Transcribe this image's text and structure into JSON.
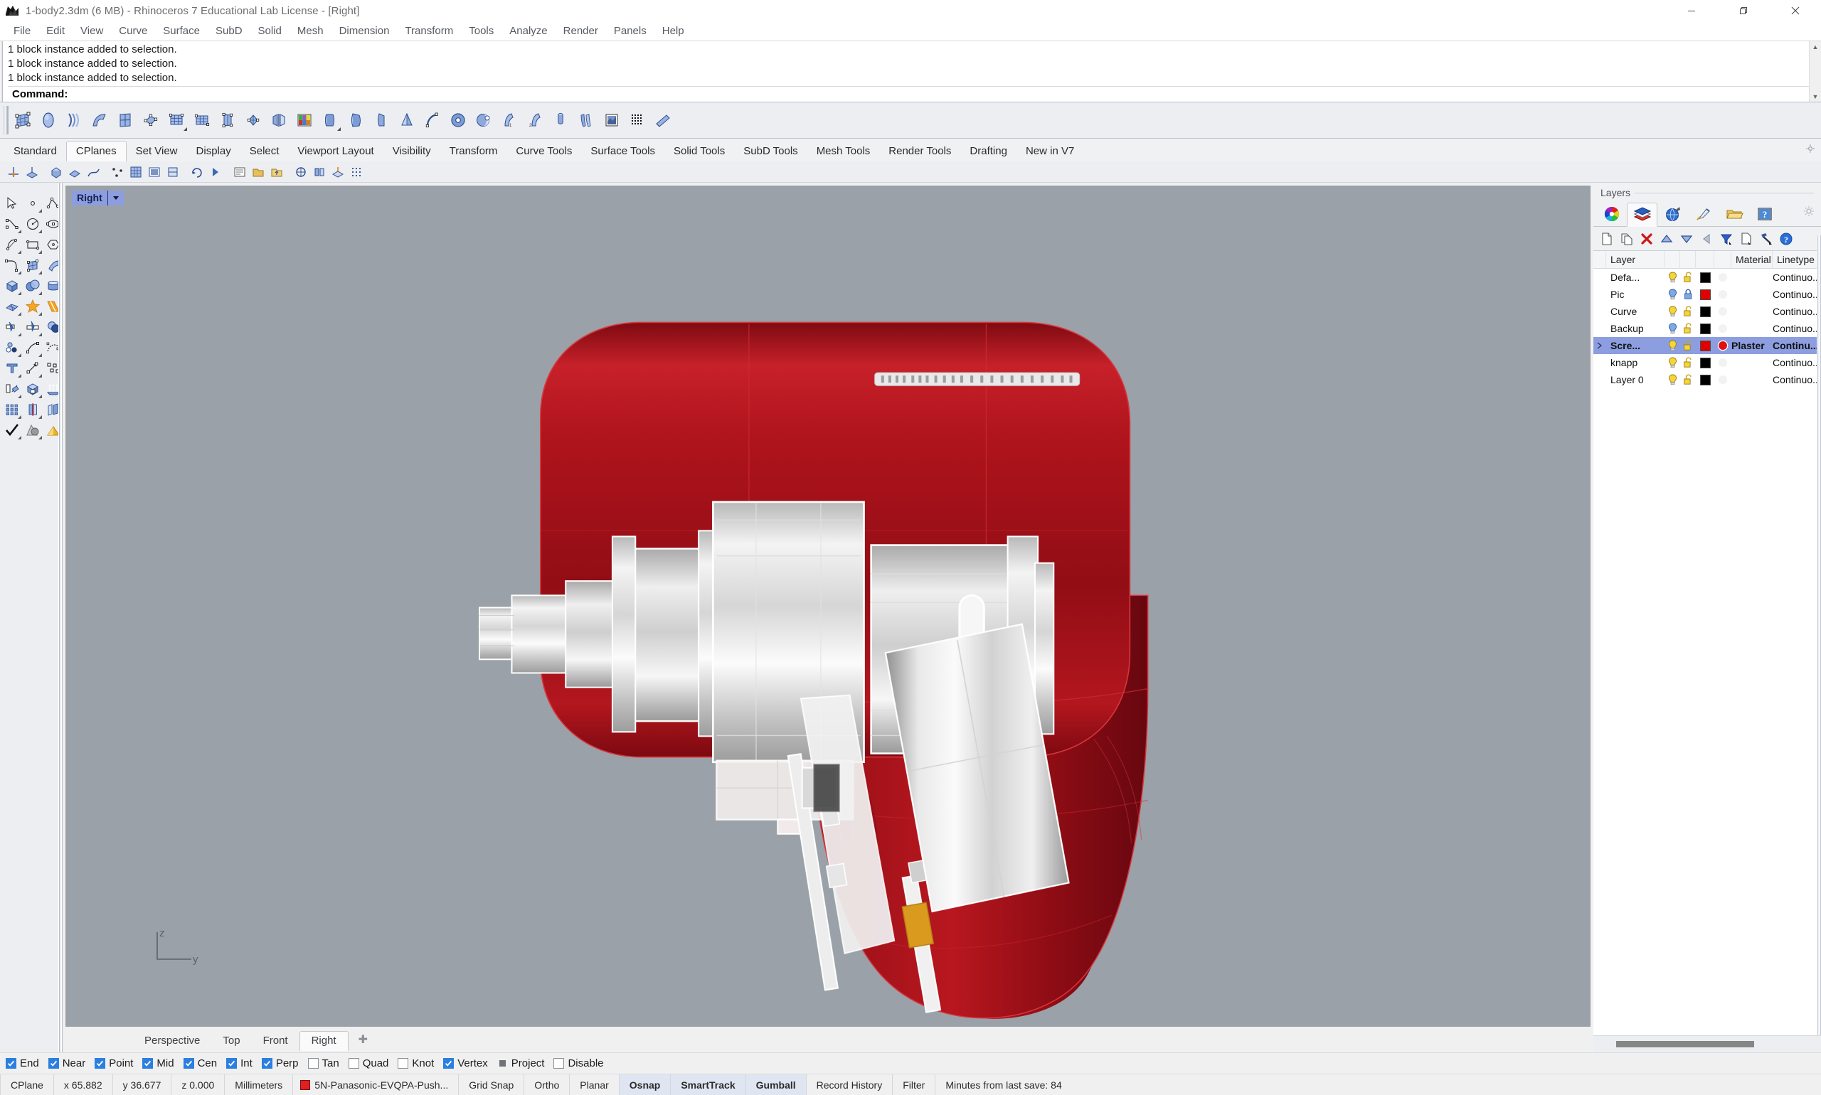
{
  "window": {
    "title": "1-body2.3dm (6 MB) - Rhinoceros 7 Educational Lab License - [Right]",
    "app_icon": "rhino-icon",
    "minimize_label": "Minimize",
    "restore_label": "Restore",
    "close_label": "Close"
  },
  "menu": {
    "items": [
      "File",
      "Edit",
      "View",
      "Curve",
      "Surface",
      "SubD",
      "Solid",
      "Mesh",
      "Dimension",
      "Transform",
      "Tools",
      "Analyze",
      "Render",
      "Panels",
      "Help"
    ]
  },
  "command_pane": {
    "history": [
      "1 block instance added to selection.",
      "1 block instance added to selection.",
      "1 block instance added to selection."
    ],
    "prompt_label": "Command:",
    "prompt_value": "",
    "scroll_up": "▲",
    "scroll_down": "▼"
  },
  "main_toolbar": {
    "buttons": [
      {
        "name": "surface-from-network-of-curves",
        "icon": "surface-network-icon"
      },
      {
        "name": "surface-from-planar-curves",
        "icon": "surface-planar-icon"
      },
      {
        "name": "loft",
        "icon": "loft-icon"
      },
      {
        "name": "sweep-1-rail",
        "icon": "sweep1-icon"
      },
      {
        "name": "sweep-2-rails",
        "icon": "sweep2-icon"
      },
      {
        "name": "surface-from-3-4-points",
        "icon": "surface-corner-points-icon"
      },
      {
        "name": "rebuild-surface",
        "icon": "rebuild-surface-icon"
      },
      {
        "name": "change-degree",
        "icon": "change-degree-icon"
      },
      {
        "name": "surface-edit-points",
        "icon": "surface-points-on-icon"
      },
      {
        "name": "match-surface",
        "icon": "match-surface-icon"
      },
      {
        "name": "symmetry",
        "icon": "symmetry-icon"
      },
      {
        "name": "render-color-swatch",
        "icon": "color-palette-icon"
      },
      {
        "name": "extrude-straight",
        "icon": "extrude-icon"
      },
      {
        "name": "extrude-tapered",
        "icon": "extrude-taper-icon"
      },
      {
        "name": "extrude-along-curve",
        "icon": "extrude-curve-icon"
      },
      {
        "name": "cone",
        "icon": "cone-icon"
      },
      {
        "name": "revolve",
        "icon": "revolve-icon"
      },
      {
        "name": "torus",
        "icon": "torus-icon"
      },
      {
        "name": "sphere",
        "icon": "sphere-icon"
      },
      {
        "name": "blend-surface",
        "icon": "blend-surface-icon"
      },
      {
        "name": "blend-surface-2",
        "icon": "blend-surface-2-icon"
      },
      {
        "name": "pipe",
        "icon": "pipe-icon"
      },
      {
        "name": "fin",
        "icon": "fin-icon"
      },
      {
        "name": "heightfield",
        "icon": "heightfield-icon"
      },
      {
        "name": "point-grid",
        "icon": "point-grid-icon"
      },
      {
        "name": "drape",
        "icon": "drape-icon"
      }
    ]
  },
  "tabs": {
    "items": [
      "Standard",
      "CPlanes",
      "Set View",
      "Display",
      "Select",
      "Viewport Layout",
      "Visibility",
      "Transform",
      "Curve Tools",
      "Surface Tools",
      "Solid Tools",
      "SubD Tools",
      "Mesh Tools",
      "Render Tools",
      "Drafting",
      "New in V7"
    ],
    "active": "CPlanes"
  },
  "sub_toolbar": {
    "buttons": [
      {
        "name": "set-cplane-origin",
        "icon": "cplane-origin-icon"
      },
      {
        "name": "set-cplane-elevation",
        "icon": "cplane-elevation-icon"
      },
      {
        "name": "set-cplane-to-object",
        "icon": "cplane-object-icon"
      },
      {
        "name": "set-cplane-to-surface",
        "icon": "cplane-surface-icon"
      },
      {
        "name": "set-cplane-to-curve",
        "icon": "cplane-curve-icon"
      },
      {
        "name": "set-cplane-by-3-points",
        "icon": "cplane-3pt-icon"
      },
      {
        "name": "cplane-world-top",
        "icon": "cplane-world-top-icon"
      },
      {
        "name": "cplane-world-front",
        "icon": "cplane-world-front-icon"
      },
      {
        "name": "cplane-world-right",
        "icon": "cplane-world-right-icon"
      },
      {
        "name": "cplane-rotate",
        "icon": "cplane-rotate-icon"
      },
      {
        "name": "cplane-next",
        "icon": "cplane-next-icon"
      },
      {
        "name": "named-cplanes",
        "icon": "named-cplanes-icon"
      },
      {
        "name": "save-cplane",
        "icon": "save-cplane-icon"
      },
      {
        "name": "restore-cplane",
        "icon": "restore-cplane-icon"
      },
      {
        "name": "cplane-universal",
        "icon": "cplane-universal-icon"
      },
      {
        "name": "cplane-align",
        "icon": "cplane-align-icon"
      },
      {
        "name": "cplane-grid-options",
        "icon": "grid-options-icon"
      },
      {
        "name": "grid-snap-toggle",
        "icon": "grid-snap-icon"
      }
    ]
  },
  "left_toolbar": {
    "buttons": [
      {
        "name": "select-objects",
        "icon": "arrow-cursor-icon"
      },
      {
        "name": "point-object",
        "icon": "point-icon"
      },
      {
        "name": "polyline",
        "icon": "polyline-icon"
      },
      {
        "name": "curve-interpolate-points",
        "icon": "curve-interp-icon"
      },
      {
        "name": "circle-center-radius",
        "icon": "circle-icon"
      },
      {
        "name": "ellipse-center",
        "icon": "ellipse-icon"
      },
      {
        "name": "arc-center-start-angle",
        "icon": "arc-icon"
      },
      {
        "name": "rectangle-corner-to-corner",
        "icon": "rectangle-icon"
      },
      {
        "name": "polygon-center-radius",
        "icon": "polygon-icon"
      },
      {
        "name": "fillet-curves",
        "icon": "fillet-icon"
      },
      {
        "name": "surface-from-edge-curves",
        "icon": "surface-edge-icon"
      },
      {
        "name": "extrude-surface",
        "icon": "extrude-surface-icon"
      },
      {
        "name": "box-corner-to-corner",
        "icon": "box-icon"
      },
      {
        "name": "boolean-union",
        "icon": "boolean-union-icon"
      },
      {
        "name": "cylinder",
        "icon": "cylinder-icon"
      },
      {
        "name": "mesh-from-surface",
        "icon": "mesh-icon"
      },
      {
        "name": "explode",
        "icon": "explode-icon"
      },
      {
        "name": "booleans-flyout",
        "icon": "boolean-split-icon"
      },
      {
        "name": "trim",
        "icon": "trim-icon"
      },
      {
        "name": "split",
        "icon": "split-icon"
      },
      {
        "name": "boolean-difference",
        "icon": "boolean-difference-icon"
      },
      {
        "name": "control-points-on",
        "icon": "control-points-icon"
      },
      {
        "name": "curve-edit-tools",
        "icon": "curve-edit-icon"
      },
      {
        "name": "blend-curves",
        "icon": "blend-curve-icon"
      },
      {
        "name": "text-object",
        "icon": "text-t-icon"
      },
      {
        "name": "move",
        "icon": "move-arrow-icon"
      },
      {
        "name": "copy",
        "icon": "copy-icon"
      },
      {
        "name": "rotate",
        "icon": "rotate-icon"
      },
      {
        "name": "scale",
        "icon": "scale-box-icon"
      },
      {
        "name": "offset-surface",
        "icon": "offset-surface-icon"
      },
      {
        "name": "array-rectangular",
        "icon": "array-grid-icon"
      },
      {
        "name": "mirror",
        "icon": "mirror-icon"
      },
      {
        "name": "orient",
        "icon": "orient-icon"
      },
      {
        "name": "check-select",
        "icon": "checkmark-icon"
      },
      {
        "name": "render-preview",
        "icon": "render-shapes-icon"
      },
      {
        "name": "render",
        "icon": "render-light-icon"
      }
    ]
  },
  "viewport": {
    "label": "Right",
    "dropdown_icon": "chevron-down-icon",
    "background_color": "#9aa1a8",
    "axis": {
      "vertical": "z",
      "horizontal": "y"
    },
    "model": {
      "name": "cordless-drill-body-assembly",
      "body_color": "#a51018",
      "body_highlight": "#cf1f26",
      "body_shadow": "#7d0b13",
      "internal_color": "#e8e8e8",
      "accent_color": "#d99a1e"
    },
    "tabs": [
      "Perspective",
      "Top",
      "Front",
      "Right"
    ],
    "active_tab": "Right",
    "add_tab_icon": "plus-icon"
  },
  "layers_panel": {
    "title": "Layers",
    "panel_tabs": [
      {
        "name": "properties-tab",
        "icon": "color-wheel-icon"
      },
      {
        "name": "layers-tab",
        "icon": "layers-stack-icon"
      },
      {
        "name": "environments-tab",
        "icon": "environment-globe-icon"
      },
      {
        "name": "materials-tab",
        "icon": "material-brush-icon"
      },
      {
        "name": "libraries-tab",
        "icon": "folder-icon"
      },
      {
        "name": "help-tab",
        "icon": "help-window-icon"
      }
    ],
    "active_panel_tab": "layers-tab",
    "gear_icon": "gear-icon",
    "toolbar": [
      {
        "name": "new-layer",
        "icon": "new-page-icon"
      },
      {
        "name": "new-sublayer",
        "icon": "copy-pages-icon"
      },
      {
        "name": "delete-layer",
        "icon": "red-x-icon"
      },
      {
        "name": "move-layer-up",
        "icon": "triangle-up-icon"
      },
      {
        "name": "move-layer-down",
        "icon": "triangle-down-icon"
      },
      {
        "name": "move-layer-left",
        "icon": "triangle-left-icon"
      },
      {
        "name": "filter-layers",
        "icon": "funnel-icon"
      },
      {
        "name": "layer-properties",
        "icon": "page-properties-icon"
      },
      {
        "name": "layer-tools",
        "icon": "hammer-icon"
      },
      {
        "name": "layers-help",
        "icon": "blue-question-icon"
      }
    ],
    "columns": [
      "Layer",
      "",
      "",
      "",
      "",
      "Material",
      "Linetype"
    ],
    "rows": [
      {
        "name": "Defa...",
        "on": true,
        "bulb": "yellow",
        "locked": false,
        "lock": "unlocked-yellow",
        "color": "#000000",
        "material": "",
        "material_swatch": "none",
        "linetype": "Continuo...",
        "selected": false,
        "expandable": false
      },
      {
        "name": "Pic",
        "on": true,
        "bulb": "blue",
        "locked": true,
        "lock": "locked-blue",
        "color": "#e00000",
        "material": "",
        "material_swatch": "none",
        "linetype": "Continuo...",
        "selected": false,
        "expandable": false
      },
      {
        "name": "Curve",
        "on": true,
        "bulb": "yellow",
        "locked": false,
        "lock": "unlocked-yellow",
        "color": "#000000",
        "material": "",
        "material_swatch": "none",
        "linetype": "Continuo...",
        "selected": false,
        "expandable": false
      },
      {
        "name": "Backup",
        "on": true,
        "bulb": "blue",
        "locked": false,
        "lock": "unlocked-yellow",
        "color": "#000000",
        "material": "",
        "material_swatch": "none",
        "linetype": "Continuo...",
        "selected": false,
        "expandable": false
      },
      {
        "name": "Scre...",
        "on": true,
        "bulb": "yellow",
        "locked": false,
        "lock": "unlocked-yellow",
        "color": "#e00000",
        "material": "Plaster",
        "material_swatch": "#e01010",
        "linetype": "Continu...",
        "selected": true,
        "expandable": true
      },
      {
        "name": "knapp",
        "on": true,
        "bulb": "yellow",
        "locked": false,
        "lock": "unlocked-yellow",
        "color": "#000000",
        "material": "",
        "material_swatch": "none",
        "linetype": "Continuo...",
        "selected": false,
        "expandable": false
      },
      {
        "name": "Layer 0",
        "on": true,
        "bulb": "yellow",
        "locked": false,
        "lock": "unlocked-yellow",
        "color": "#000000",
        "material": "",
        "material_swatch": "none",
        "linetype": "Continuo...",
        "selected": false,
        "expandable": false
      }
    ]
  },
  "osnap": {
    "items": [
      {
        "label": "End",
        "checked": true,
        "state": "on"
      },
      {
        "label": "Near",
        "checked": true,
        "state": "on"
      },
      {
        "label": "Point",
        "checked": true,
        "state": "on"
      },
      {
        "label": "Mid",
        "checked": true,
        "state": "on"
      },
      {
        "label": "Cen",
        "checked": true,
        "state": "on"
      },
      {
        "label": "Int",
        "checked": true,
        "state": "on"
      },
      {
        "label": "Perp",
        "checked": true,
        "state": "on"
      },
      {
        "label": "Tan",
        "checked": false,
        "state": "off"
      },
      {
        "label": "Quad",
        "checked": false,
        "state": "off"
      },
      {
        "label": "Knot",
        "checked": false,
        "state": "off"
      },
      {
        "label": "Vertex",
        "checked": true,
        "state": "on"
      },
      {
        "label": "Project",
        "checked": false,
        "state": "grey"
      },
      {
        "label": "Disable",
        "checked": false,
        "state": "off"
      }
    ]
  },
  "status_bar": {
    "cplane_label": "CPlane",
    "x": "x 65.882",
    "y": "y 36.677",
    "z": "z 0.000",
    "units": "Millimeters",
    "layer_swatch_color": "#e02020",
    "current_layer": "5N-Panasonic-EVQPA-Push...",
    "toggles": [
      {
        "label": "Grid Snap",
        "active": false
      },
      {
        "label": "Ortho",
        "active": false
      },
      {
        "label": "Planar",
        "active": false
      },
      {
        "label": "Osnap",
        "active": true
      },
      {
        "label": "SmartTrack",
        "active": true
      },
      {
        "label": "Gumball",
        "active": true
      },
      {
        "label": "Record History",
        "active": false
      },
      {
        "label": "Filter",
        "active": false
      }
    ],
    "save_info": "Minutes from last save: 84"
  }
}
